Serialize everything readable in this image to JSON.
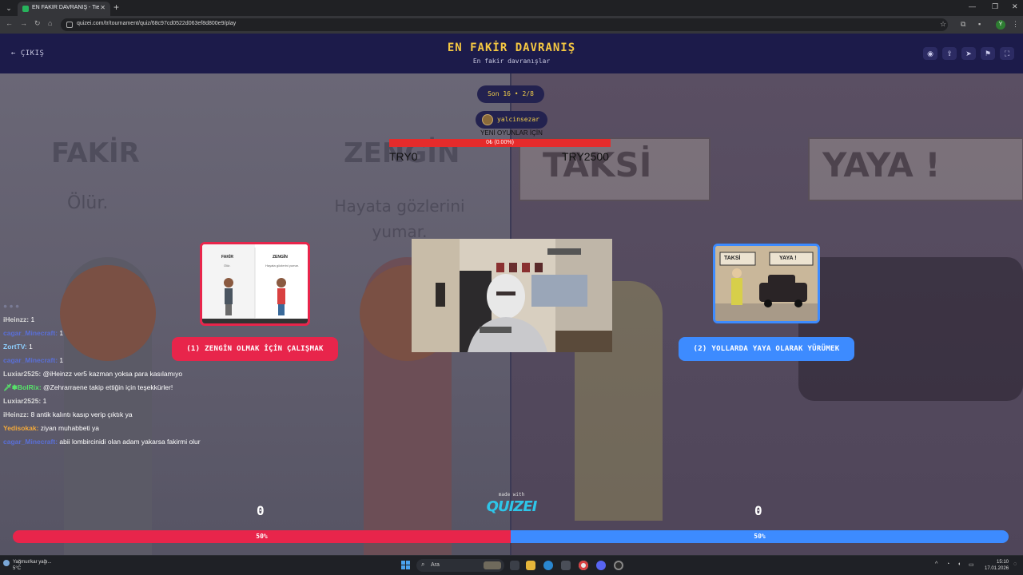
{
  "browser": {
    "tab_title": "EN FAKİR DAVRANIŞ - Tier List",
    "url": "quizei.com/tr/tournament/quiz/68c97cd0522d063ef8d800e9/play"
  },
  "header": {
    "back_label": "ÇIKIŞ",
    "title": "EN FAKİR DAVRANIŞ",
    "subtitle": "En fakir davranışlar",
    "icons": [
      "eye-icon",
      "share-icon",
      "send-icon",
      "flag-icon",
      "fullscreen-icon"
    ]
  },
  "round": {
    "label": "Son 16 • 2/8",
    "streamer": "yalcinsezar"
  },
  "goal": {
    "label": "YENİ OYUNLAR İÇİN",
    "bar_text": "0₺ (0.00%)",
    "min": "TRY0",
    "max": "TRY2500",
    "progress": 0
  },
  "options": {
    "left": {
      "label": "(1) ZENGİN OLMAK İÇİN ÇALIŞMAK",
      "card_left_word": "FAKİR",
      "card_right_word": "ZENGİN",
      "card_left_sub": "Ölür.",
      "card_right_sub": "Hayata gözlerini yumar.",
      "votes": "0",
      "percent": "50%"
    },
    "right": {
      "label": "(2) YOLLARDA YAYA OLARAK YÜRÜMEK",
      "card_sign_left": "TAKSİ",
      "card_sign_right": "YAYA !",
      "votes": "0",
      "percent": "50%"
    }
  },
  "background": {
    "left_word_1": "FAKİR",
    "left_word_2": "ZENGİN",
    "left_sub_1": "Ölür.",
    "left_sub_2": "Hayata gözlerini yumar.",
    "right_word_1": "TAKSİ",
    "right_word_2": "YAYA !"
  },
  "chat": [
    {
      "user": "● ● ●",
      "text": "",
      "color": "#8a8fb0"
    },
    {
      "user": "iHeinzz:",
      "text": "1",
      "color": "#d7d7d7"
    },
    {
      "user": "cagar_Minecraft:",
      "text": "1",
      "color": "#5a6fd6"
    },
    {
      "user": "ZortTV:",
      "text": "1",
      "color": "#8fd0ff"
    },
    {
      "user": "cagar_Minecraft:",
      "text": "1",
      "color": "#5a6fd6"
    },
    {
      "user": "Luxiar2525:",
      "text": "@iHeinzz ver5 kazman yoksa para kasılamıyo",
      "color": "#d7d7d7"
    },
    {
      "user": "🗡✽BolRix:",
      "text": "@Zehrarraene takip ettiğin için teşekkürler!",
      "color": "#57e36a"
    },
    {
      "user": "Luxiar2525:",
      "text": "1",
      "color": "#d7d7d7"
    },
    {
      "user": "iHeinzz:",
      "text": "8 antik kalıntı kasıp verip çıktık ya",
      "color": "#d7d7d7"
    },
    {
      "user": "Yedisokak:",
      "text": "ziyan muhabbeti ya",
      "color": "#f2a93b"
    },
    {
      "user": "cagar_Minecraft:",
      "text": "abii lombircinidi olan adam yakarsa fakirmi olur",
      "color": "#5a6fd6"
    }
  ],
  "footer": {
    "made_with": "made with",
    "logo": "QUIZEI"
  },
  "taskbar": {
    "weather_line_1": "Yağmur/kar yağı...",
    "weather_line_2": "5°C",
    "search_label": "Ara",
    "time": "15:10",
    "date": "17.01.2026"
  },
  "colors": {
    "left_accent": "#e8254b",
    "right_accent": "#3d8bff",
    "title_gold": "#f5c842",
    "header_bg": "#1c1b4a"
  }
}
